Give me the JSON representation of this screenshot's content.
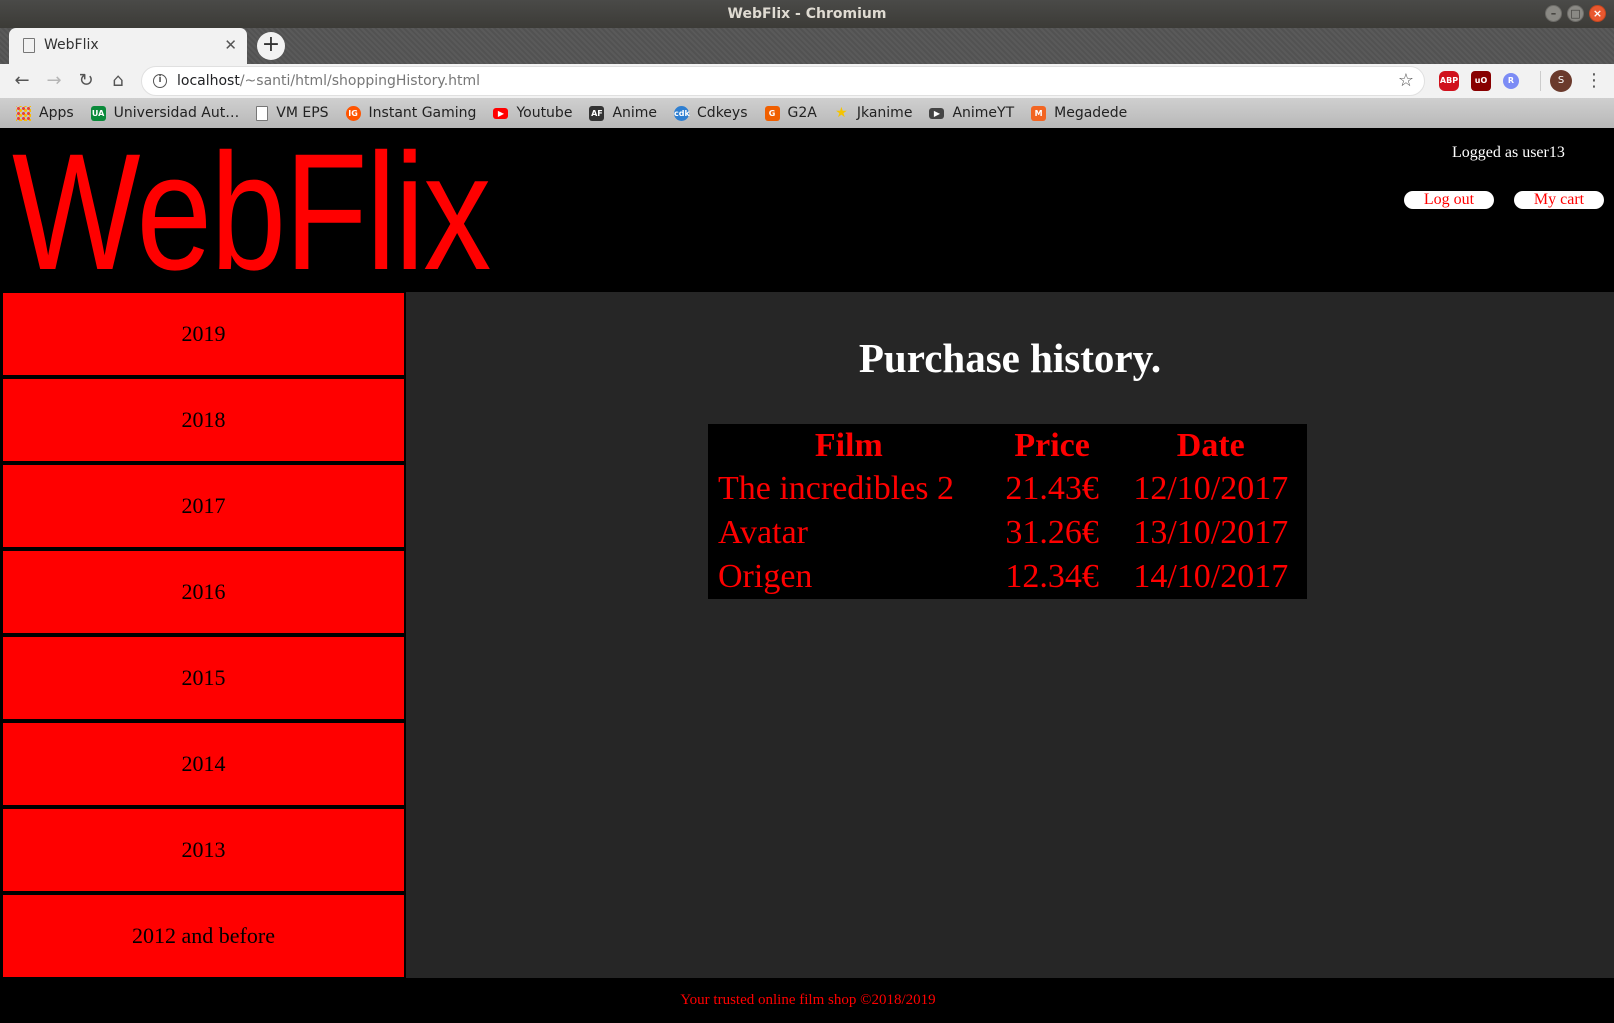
{
  "window": {
    "title": "WebFlix - Chromium"
  },
  "browser": {
    "tab_title": "WebFlix",
    "url_host": "localhost",
    "url_path": "/~santi/html/shoppingHistory.html",
    "extensions": [
      "ABP",
      "uO",
      "R"
    ],
    "profile_initial": "S"
  },
  "bookmarks": [
    {
      "label": "Apps",
      "icon": "apps-icon",
      "color": "#e94235"
    },
    {
      "label": "Universidad Aut…",
      "icon": "uam-icon",
      "color": "#0a8a3a"
    },
    {
      "label": "VM EPS",
      "icon": "page-icon",
      "color": "#ffffff"
    },
    {
      "label": "Instant Gaming",
      "icon": "instant-gaming-icon",
      "color": "#ff5400"
    },
    {
      "label": "Youtube",
      "icon": "youtube-icon",
      "color": "#ff0000"
    },
    {
      "label": "Anime",
      "icon": "animeflv-icon",
      "color": "#333333"
    },
    {
      "label": "Cdkeys",
      "icon": "cdkeys-icon",
      "color": "#2f7fd1"
    },
    {
      "label": "G2A",
      "icon": "g2a-icon",
      "color": "#f05f00"
    },
    {
      "label": "Jkanime",
      "icon": "jkanime-icon",
      "color": "#f5c400"
    },
    {
      "label": "AnimeYT",
      "icon": "animeyt-icon",
      "color": "#444444"
    },
    {
      "label": "Megadede",
      "icon": "megadede-icon",
      "color": "#f26522"
    }
  ],
  "site": {
    "logo": "WebFlix",
    "login_status": "Logged as user13",
    "logout_label": "Log out",
    "cart_label": "My cart",
    "accent_color": "#ff0000"
  },
  "sidebar": {
    "years": [
      "2019",
      "2018",
      "2017",
      "2016",
      "2015",
      "2014",
      "2013",
      "2012 and before"
    ]
  },
  "main": {
    "title": "Purchase history.",
    "table": {
      "headers": [
        "Film",
        "Price",
        "Date"
      ],
      "rows": [
        [
          "The incredibles 2",
          "21.43€",
          "12/10/2017"
        ],
        [
          "Avatar",
          "31.26€",
          "13/10/2017"
        ],
        [
          "Origen",
          "12.34€",
          "14/10/2017"
        ]
      ]
    }
  },
  "footer": {
    "text": "Your trusted online film shop ©2018/2019"
  }
}
